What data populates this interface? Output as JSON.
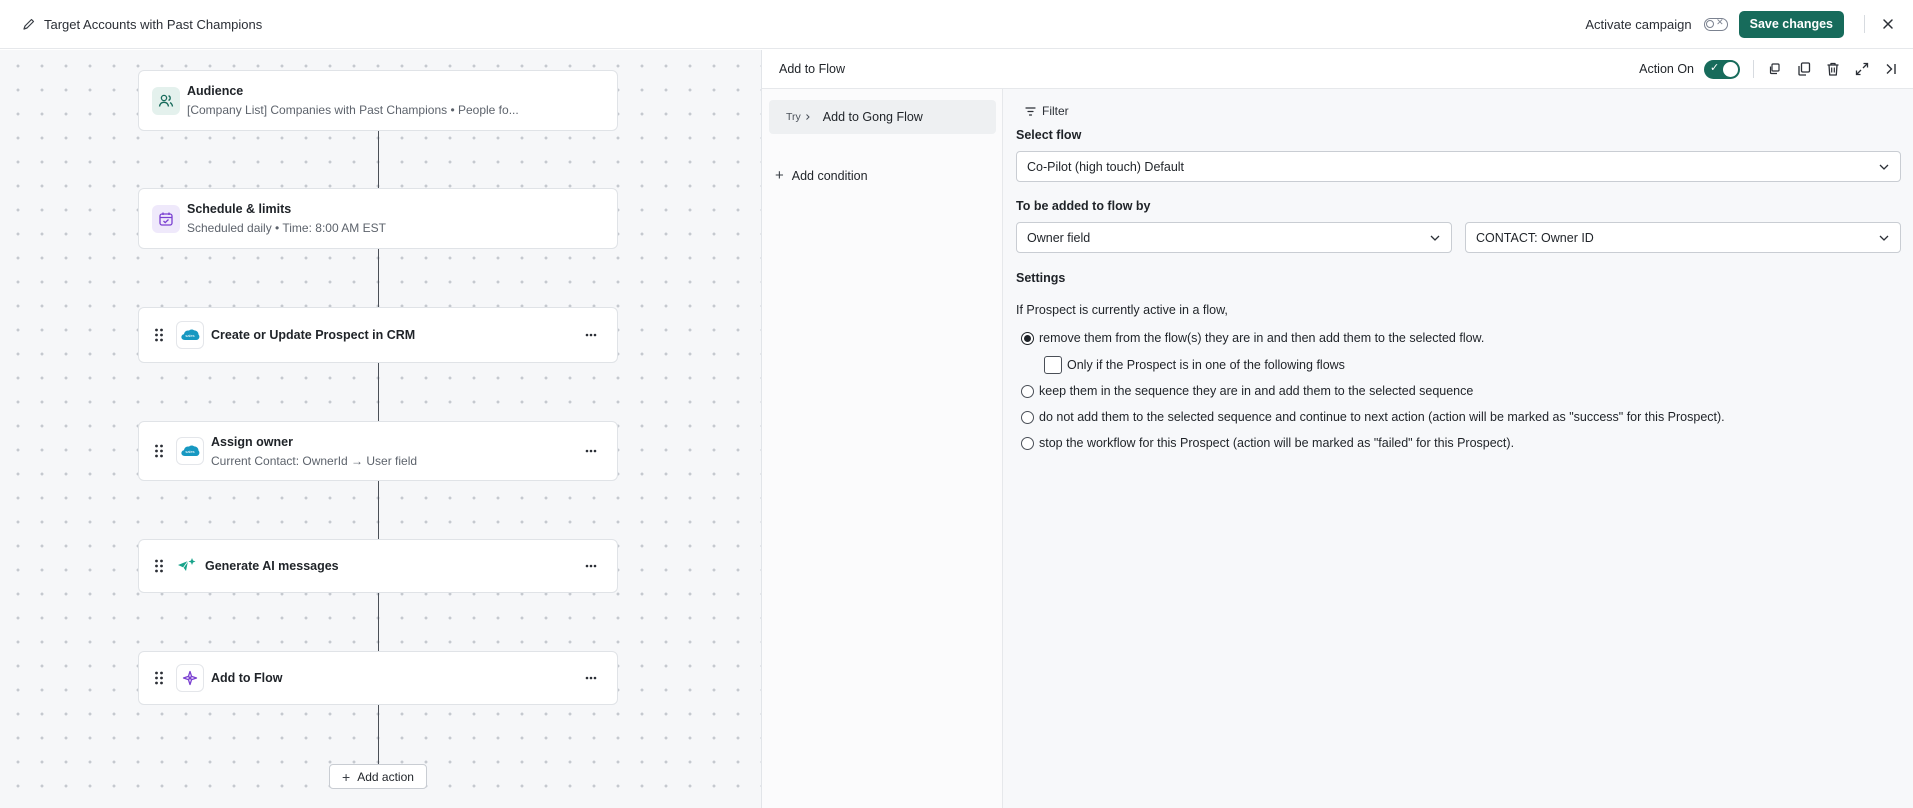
{
  "header": {
    "title": "Target Accounts with Past Champions",
    "activate_label": "Activate campaign",
    "save_label": "Save changes"
  },
  "canvas": {
    "nodes": [
      {
        "title": "Audience",
        "subtitle": "[Company List] Companies with Past Champions • People fo...",
        "icon": "people-icon"
      },
      {
        "title": "Schedule & limits",
        "subtitle": "Scheduled daily • Time: 8:00 AM EST",
        "icon": "calendar-check-icon"
      },
      {
        "title": "Create or Update Prospect in CRM",
        "subtitle": "",
        "icon": "salesforce-icon"
      },
      {
        "title": "Assign owner",
        "subtitle": "Current Contact: OwnerId → User field",
        "icon": "salesforce-icon"
      },
      {
        "title": "Generate AI messages",
        "subtitle": "",
        "icon": "ai-sparkle-icon"
      },
      {
        "title": "Add to Flow",
        "subtitle": "",
        "icon": "flow-icon"
      }
    ],
    "add_action_label": "Add action"
  },
  "panel": {
    "title": "Add to Flow",
    "action_on_label": "Action On",
    "filters": [
      {
        "badge": "Try",
        "label": "Add to Gong Flow"
      }
    ],
    "add_condition_label": "Add condition",
    "filter_tag": "Filter",
    "select_flow_label": "Select flow",
    "select_flow_value": "Co-Pilot (high touch) Default",
    "added_by_label": "To be added to flow by",
    "added_by_value": "Owner field",
    "owner_field_value": "CONTACT: Owner ID",
    "settings_label": "Settings",
    "settings_intro": "If Prospect is currently active in a flow,",
    "options": [
      {
        "label": "remove them from the flow(s) they are in and then add them to the selected flow.",
        "selected": true
      },
      {
        "label": "keep them in the sequence they are in and add them to the selected sequence",
        "selected": false
      },
      {
        "label": "do not add them to the selected sequence and continue to next action (action will be marked as \"success\" for this Prospect).",
        "selected": false
      },
      {
        "label": "stop the workflow for this Prospect (action will be marked as \"failed\" for this Prospect).",
        "selected": false
      }
    ],
    "sub_checkbox_label": "Only if the Prospect is in one of the following flows"
  },
  "colors": {
    "accent": "#176b5b",
    "canvas_bg": "#f6f7f9",
    "audience_icon_bg": "#e4f1ed",
    "schedule_icon_bg": "#efe9fb"
  }
}
